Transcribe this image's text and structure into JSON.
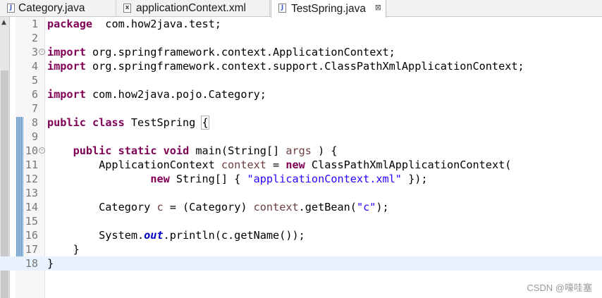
{
  "tabs": [
    {
      "label": "Category.java",
      "icon": "java-file-icon",
      "icon_glyph": "J",
      "active": false
    },
    {
      "label": "applicationContext.xml",
      "icon": "xml-file-icon",
      "icon_glyph": "x",
      "active": false
    },
    {
      "label": "TestSpring.java",
      "icon": "java-file-icon",
      "icon_glyph": "J",
      "active": true,
      "close_glyph": "⊠"
    }
  ],
  "editor": {
    "current_line": 18,
    "lines": [
      {
        "n": "1",
        "tokens": [
          [
            "kw",
            "package"
          ],
          [
            "",
            "  com.how2java.test;"
          ]
        ]
      },
      {
        "n": "2",
        "tokens": []
      },
      {
        "n": "3",
        "fold": "-",
        "tokens": [
          [
            "kw",
            "import"
          ],
          [
            "",
            " org.springframework.context.ApplicationContext;"
          ]
        ]
      },
      {
        "n": "4",
        "tokens": [
          [
            "kw",
            "import"
          ],
          [
            "",
            " org.springframework.context.support.ClassPathXmlApplicationContext;"
          ]
        ]
      },
      {
        "n": "5",
        "tokens": []
      },
      {
        "n": "6",
        "tokens": [
          [
            "kw",
            "import"
          ],
          [
            "",
            " com.how2java.pojo.Category;"
          ]
        ]
      },
      {
        "n": "7",
        "tokens": []
      },
      {
        "n": "8",
        "tokens": [
          [
            "kw",
            "public"
          ],
          [
            "",
            " "
          ],
          [
            "kw",
            "class"
          ],
          [
            "",
            " TestSpring "
          ],
          [
            "bm",
            "{"
          ]
        ]
      },
      {
        "n": "9",
        "tokens": []
      },
      {
        "n": "10",
        "fold": "-",
        "tokens": [
          [
            "",
            "    "
          ],
          [
            "kw",
            "public"
          ],
          [
            "",
            " "
          ],
          [
            "kw",
            "static"
          ],
          [
            "",
            " "
          ],
          [
            "kw",
            "void"
          ],
          [
            "",
            " main(String[] "
          ],
          [
            "lv",
            "args"
          ],
          [
            "",
            " ) {"
          ]
        ]
      },
      {
        "n": "11",
        "tokens": [
          [
            "",
            "        ApplicationContext "
          ],
          [
            "lv",
            "context"
          ],
          [
            "",
            " = "
          ],
          [
            "kw",
            "new"
          ],
          [
            "",
            " ClassPathXmlApplicationContext("
          ]
        ]
      },
      {
        "n": "12",
        "tokens": [
          [
            "",
            "                "
          ],
          [
            "kw",
            "new"
          ],
          [
            "",
            " String[] { "
          ],
          [
            "str",
            "\"applicationContext.xml\""
          ],
          [
            "",
            " });"
          ]
        ]
      },
      {
        "n": "13",
        "tokens": []
      },
      {
        "n": "14",
        "tokens": [
          [
            "",
            "        Category "
          ],
          [
            "lv",
            "c"
          ],
          [
            "",
            " = (Category) "
          ],
          [
            "lv",
            "context"
          ],
          [
            "",
            ".getBean("
          ],
          [
            "str",
            "\"c\""
          ],
          [
            "",
            ");"
          ]
        ]
      },
      {
        "n": "15",
        "tokens": []
      },
      {
        "n": "16",
        "tokens": [
          [
            "",
            "        System."
          ],
          [
            "fld",
            "out"
          ],
          [
            "",
            ".println(c.getName());"
          ]
        ]
      },
      {
        "n": "17",
        "tokens": [
          [
            "",
            "    }"
          ]
        ]
      },
      {
        "n": "18",
        "tokens": [
          [
            "",
            "}"
          ]
        ]
      }
    ]
  },
  "watermark": "CSDN @嚎哇塞"
}
